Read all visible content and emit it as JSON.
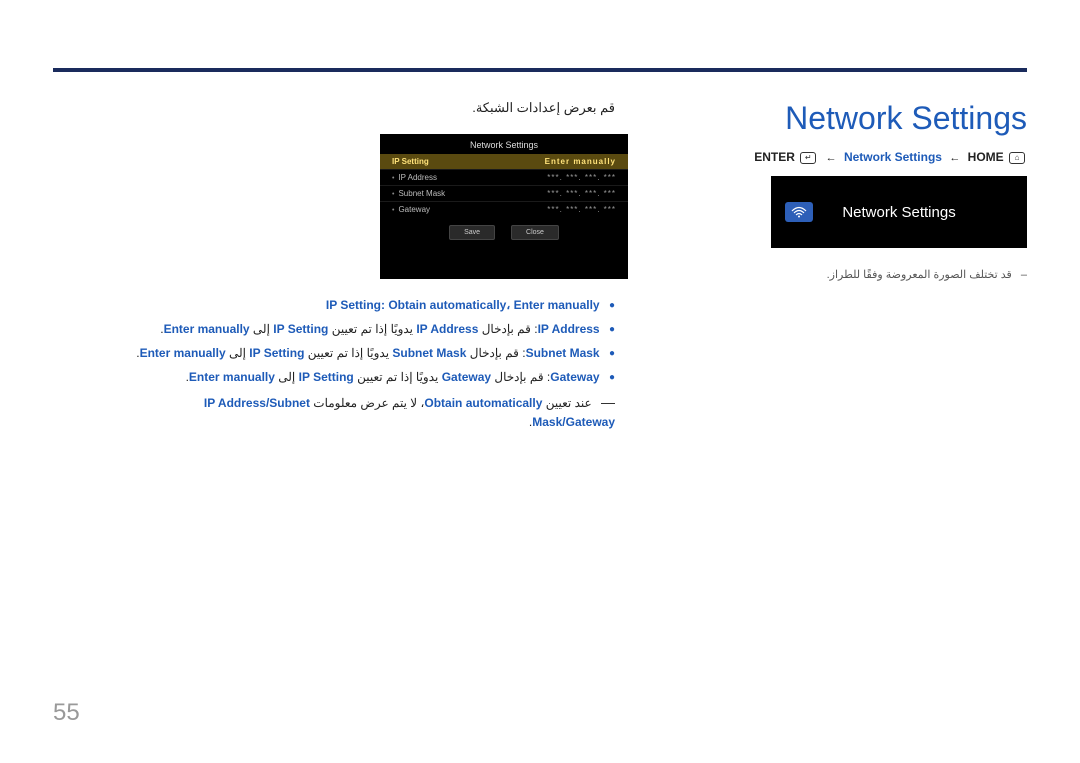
{
  "page": {
    "number": "55"
  },
  "header": {
    "title": "Network Settings",
    "breadcrumb": {
      "enter_label": "ENTER",
      "middle": "Network Settings",
      "home_label": "HOME"
    }
  },
  "tile": {
    "label": "Network Settings"
  },
  "note": {
    "dash": "–",
    "text": "قد تختلف الصورة المعروضة وفقًا للطراز."
  },
  "intro": "قم بعرض إعدادات الشبكة.",
  "osd": {
    "title": "Network Settings",
    "rows": {
      "ip_setting": {
        "label": "IP Setting",
        "value": "Enter manually"
      },
      "ip_address": {
        "label": "IP Address",
        "value": "***. ***. ***. ***"
      },
      "subnet_mask": {
        "label": "Subnet Mask",
        "value": "***. ***. ***. ***"
      },
      "gateway": {
        "label": "Gateway",
        "value": "***. ***. ***. ***"
      }
    },
    "buttons": {
      "save": "Save",
      "close": "Close"
    }
  },
  "list": {
    "r1": {
      "lead": "IP Setting",
      "colon": ": ",
      "opt1": "Obtain automatically",
      "sep": "، ",
      "opt2": "Enter manually"
    },
    "r2": {
      "lead": "IP Address",
      "t1": ": قم بإدخال ",
      "k1": "IP Address",
      "t2": " يدويًا إذا تم تعيين ",
      "k2": "IP Setting",
      "t3": " إلى ",
      "k3": "Enter manually",
      "t4": "."
    },
    "r3": {
      "lead": "Subnet Mask",
      "t1": ": قم بإدخال ",
      "k1": "Subnet Mask",
      "t2": " يدويًا إذا تم تعيين ",
      "k2": "IP Setting",
      "t3": " إلى ",
      "k3": "Enter manually",
      "t4": "."
    },
    "r4": {
      "lead": "Gateway",
      "t1": ": قم بإدخال ",
      "k1": "Gateway",
      "t2": " يدويًا إذا تم تعيين ",
      "k2": "IP Setting",
      "t3": " إلى ",
      "k3": "Enter manually",
      "t4": "."
    },
    "r5": {
      "t1": "عند تعيين ",
      "k1": "Obtain automatically",
      "t2": "، لا يتم عرض معلومات ",
      "k2": "IP Address",
      "sep1": "/",
      "k3": "Subnet Mask",
      "sep2": "/",
      "k4": "Gateway",
      "t3": "."
    }
  }
}
